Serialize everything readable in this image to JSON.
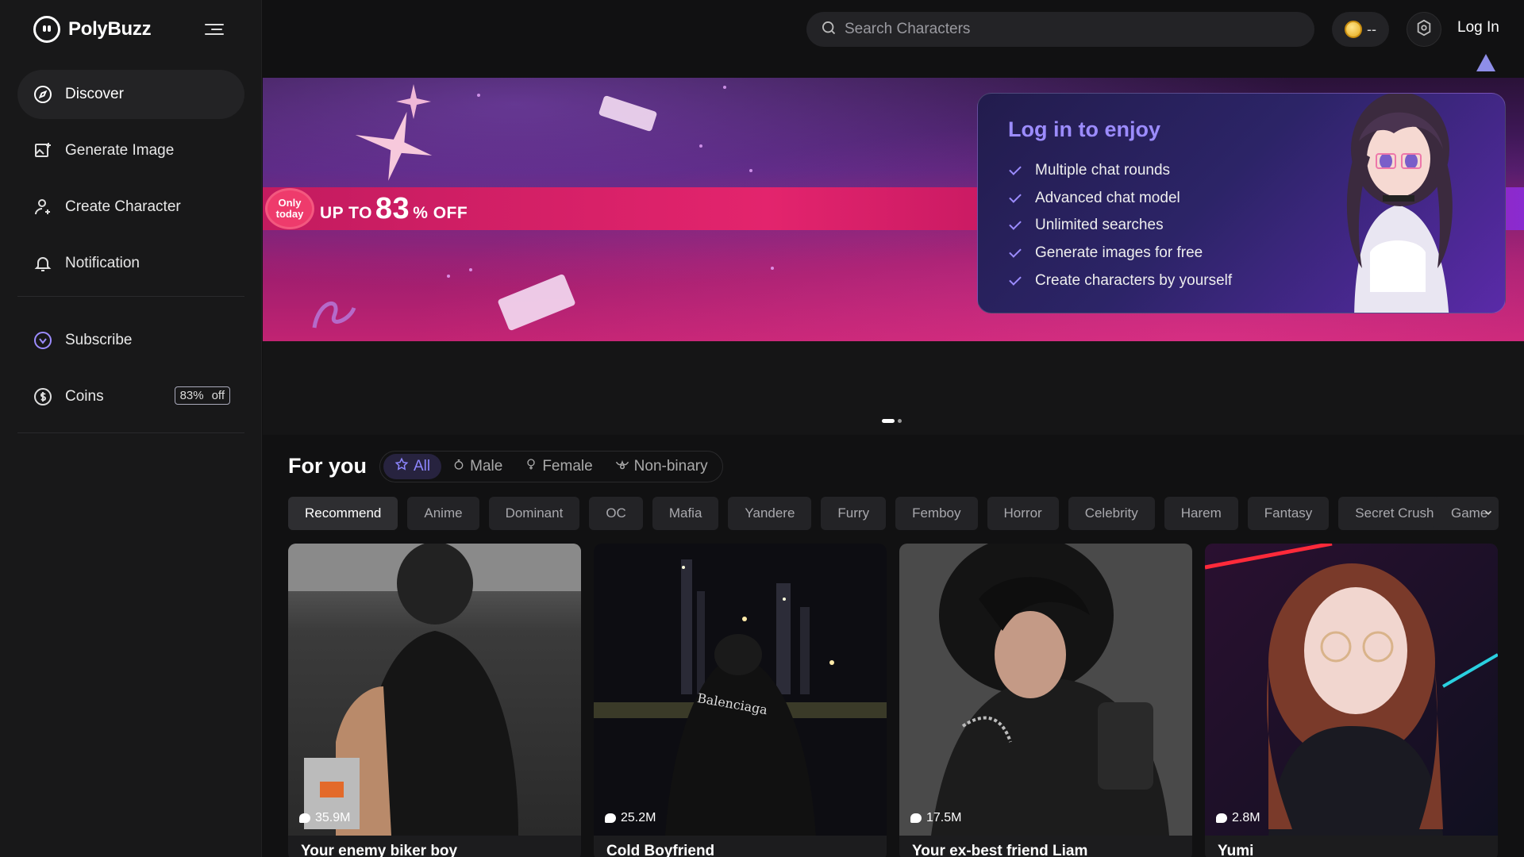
{
  "brand": {
    "name": "PolyBuzz"
  },
  "sidebar": {
    "items": [
      {
        "label": "Discover",
        "icon": "compass-icon"
      },
      {
        "label": "Generate Image",
        "icon": "image-plus-icon"
      },
      {
        "label": "Create Character",
        "icon": "user-plus-icon"
      },
      {
        "label": "Notification",
        "icon": "bell-icon"
      }
    ],
    "secondary": [
      {
        "label": "Subscribe",
        "icon": "crown-icon"
      },
      {
        "label": "Coins",
        "icon": "dollar-coin-icon",
        "badge_percent": "83%",
        "badge_off": "off"
      }
    ]
  },
  "topbar": {
    "search_placeholder": "Search Characters",
    "coin_value": "--",
    "login_label": "Log In"
  },
  "banner": {
    "only_line1": "Only",
    "only_line2": "today",
    "promo_prefix": "UP TO",
    "promo_number": "83",
    "promo_suffix": "% OFF",
    "card_title": "Log in to enjoy",
    "benefits": [
      "Multiple chat rounds",
      "Advanced chat model",
      "Unlimited searches",
      "Generate images for free",
      "Create characters by yourself"
    ]
  },
  "foryou": {
    "title": "For you",
    "gender_tabs": [
      "All",
      "Male",
      "Female",
      "Non-binary"
    ],
    "categories": [
      "Recommend",
      "Anime",
      "Dominant",
      "OC",
      "Mafia",
      "Yandere",
      "Furry",
      "Femboy",
      "Horror",
      "Celebrity",
      "Harem",
      "Fantasy",
      "Secret Crush"
    ],
    "more_chip": "Game"
  },
  "cards": [
    {
      "name": "Your enemy biker boy",
      "stats": "35.9M"
    },
    {
      "name": "Cold Boyfriend",
      "stats": "25.2M"
    },
    {
      "name": "Your ex-best friend Liam",
      "stats": "17.5M"
    },
    {
      "name": "Yumi",
      "stats": "2.8M"
    }
  ],
  "colors": {
    "accent": "#8d86ff",
    "background": "#111112",
    "sidebar": "#181819",
    "promo_pink": "#e3246d"
  }
}
